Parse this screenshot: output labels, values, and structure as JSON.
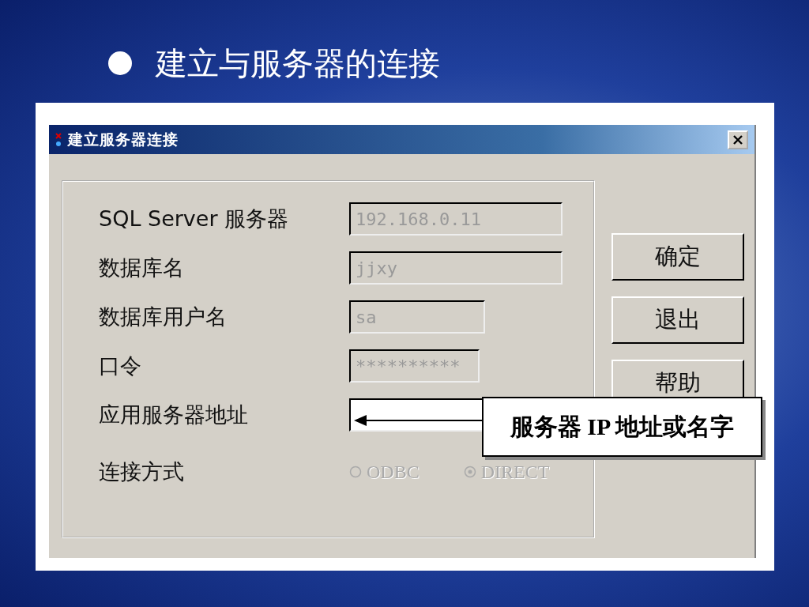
{
  "slide_title": "建立与服务器的连接",
  "dialog": {
    "title": "建立服务器连接",
    "fields": [
      {
        "label": "SQL Server 服务器",
        "value": "192.168.0.11",
        "disabled": true
      },
      {
        "label": "数据库名",
        "value": "jjxy",
        "disabled": true
      },
      {
        "label": "数据库用户名",
        "value": "sa",
        "disabled": true
      },
      {
        "label": "口令",
        "value": "**********",
        "disabled": true
      },
      {
        "label": "应用服务器地址",
        "disabled": false
      }
    ],
    "connection": {
      "label": "连接方式",
      "disabled": true,
      "options": [
        {
          "label": "ODBC",
          "selected": false
        },
        {
          "label": "DIRECT",
          "selected": true
        }
      ]
    },
    "buttons": [
      "确定",
      "退出",
      "帮助"
    ]
  },
  "callout": "服务器 IP 地址或名字"
}
